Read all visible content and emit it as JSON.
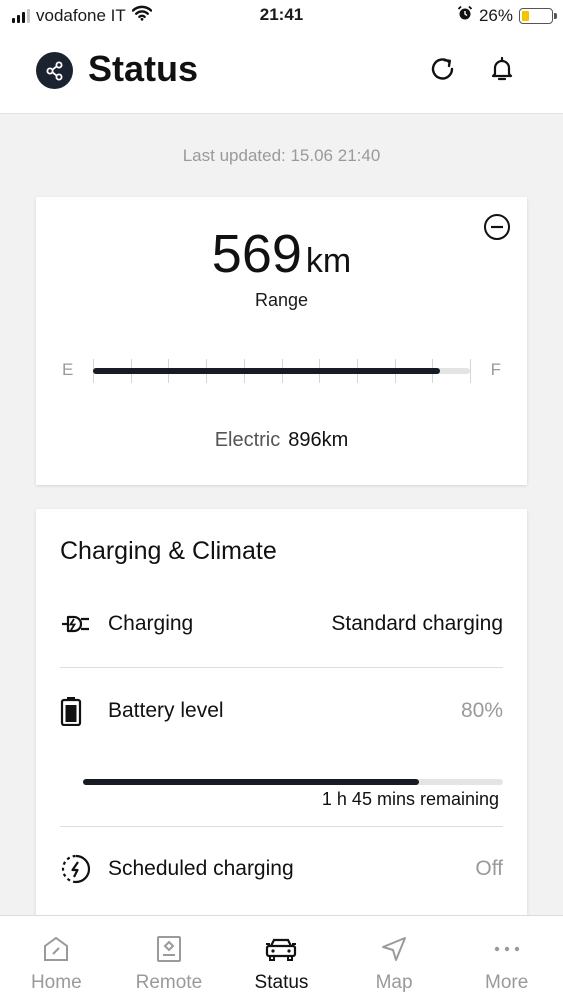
{
  "status_bar": {
    "carrier": "vodafone IT",
    "time": "21:41",
    "battery_percent": "26%",
    "battery_level": 0.26,
    "battery_color": "#f5c400",
    "icons": [
      "signal-icon",
      "wifi-icon",
      "alarm-icon",
      "battery-icon"
    ]
  },
  "header": {
    "title": "Status",
    "icons": [
      "share-logo-icon",
      "refresh-icon",
      "bell-icon"
    ]
  },
  "last_updated": "Last updated: 15.06 21:40",
  "range_card": {
    "range_value": "569",
    "range_unit": "km",
    "range_label": "Range",
    "gauge_empty_label": "E",
    "gauge_full_label": "F",
    "gauge_level": 0.92,
    "electric_label": "Electric",
    "electric_value": "896km",
    "icons": [
      "collapse-minus-icon"
    ]
  },
  "charging_card": {
    "title": "Charging & Climate",
    "rows": [
      {
        "label": "Charging",
        "value": "Standard charging",
        "icon": "charging-plug-icon"
      },
      {
        "label": "Battery level",
        "value": "80%",
        "icon": "battery-level-icon"
      },
      {
        "label": "Scheduled charging",
        "value": "Off",
        "icon": "scheduled-charging-icon"
      }
    ],
    "battery_level": 0.8,
    "remaining": "1 h 45 mins remaining"
  },
  "tabs": [
    {
      "label": "Home",
      "icon": "home-icon",
      "active": false
    },
    {
      "label": "Remote",
      "icon": "remote-icon",
      "active": false
    },
    {
      "label": "Status",
      "icon": "car-icon",
      "active": true
    },
    {
      "label": "Map",
      "icon": "navigation-arrow-icon",
      "active": false
    },
    {
      "label": "More",
      "icon": "more-dots-icon",
      "active": false
    }
  ],
  "colors": {
    "accent_dark": "#161b24",
    "muted_text": "#9a9a9a",
    "background": "#f2f2f2"
  }
}
